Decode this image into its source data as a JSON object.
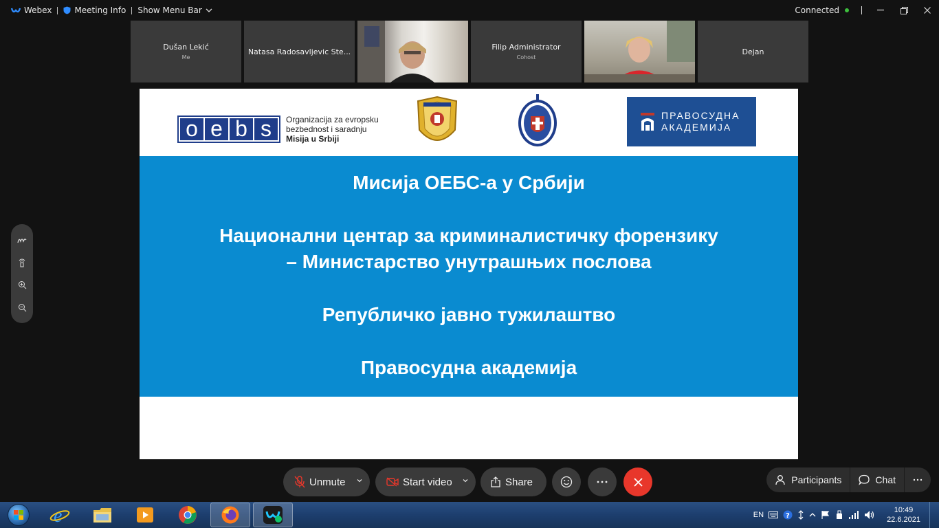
{
  "topbar": {
    "app_name": "Webex",
    "meeting_info": "Meeting Info",
    "show_menu_bar": "Show Menu Bar",
    "status": "Connected"
  },
  "participants_strip": [
    {
      "name": "Dušan Lekić",
      "subtitle": "Me",
      "video": false
    },
    {
      "name": "Natasa Radosavljevic Ste...",
      "subtitle": "",
      "video": false
    },
    {
      "name": "",
      "subtitle": "",
      "video": true
    },
    {
      "name": "Filip Administrator",
      "subtitle": "Cohost",
      "video": false
    },
    {
      "name": "",
      "subtitle": "",
      "video": true
    },
    {
      "name": "Dejan",
      "subtitle": "",
      "video": false
    }
  ],
  "slide": {
    "oebs_letters": [
      "o",
      "e",
      "b",
      "s"
    ],
    "oebs_text": [
      "Organizacija za evropsku",
      "bezbednost i saradnju",
      "Misija u Srbiji"
    ],
    "academy_logo_text": [
      "ПРАВОСУДНА",
      "АКАДЕМИЈА"
    ],
    "lines": [
      "Мисија ОЕБС-а у Србији",
      "Национални центар за криминалистичку форензику",
      "– Министарство унутрашњих послова",
      "Републичко јавно тужилаштво",
      "Правосудна академија"
    ],
    "colors": {
      "banner": "#0a8bd0",
      "oebs_blue": "#1f3d8a",
      "academy_blue": "#1e4f94"
    }
  },
  "controls": {
    "unmute": "Unmute",
    "start_video": "Start video",
    "share": "Share",
    "participants": "Participants",
    "chat": "Chat"
  },
  "taskbar": {
    "language": "EN",
    "time": "10:49",
    "date": "22.6.2021"
  }
}
